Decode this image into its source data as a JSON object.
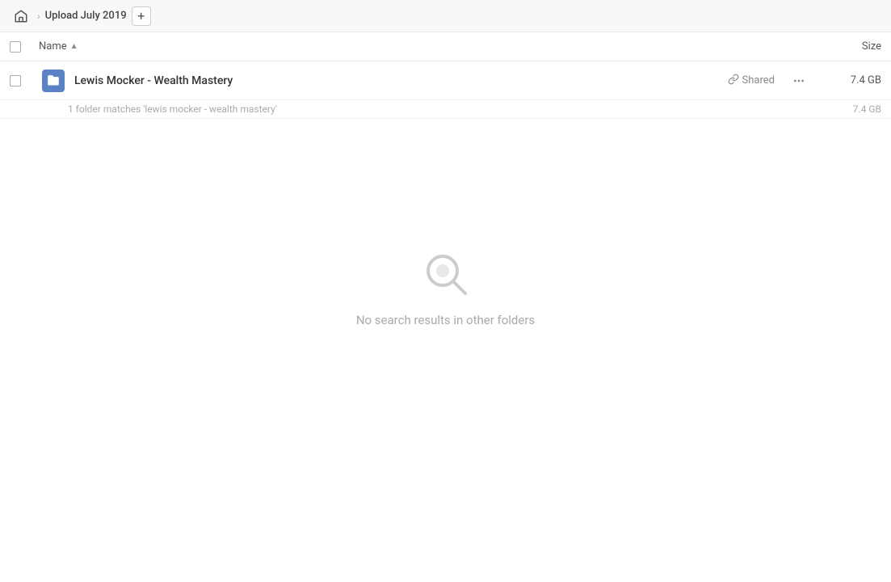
{
  "breadcrumb": {
    "home_icon": "🏠",
    "separator": "›",
    "title": "Upload July 2019",
    "add_button_label": "+"
  },
  "columns": {
    "name_label": "Name",
    "sort_indicator": "▲",
    "size_label": "Size"
  },
  "file_row": {
    "name": "Lewis Mocker - Wealth Mastery",
    "shared_label": "Shared",
    "size": "7.4 GB",
    "more_options_icon": "···"
  },
  "match_info": {
    "text": "1 folder matches 'lewis mocker - wealth mastery'",
    "size": "7.4 GB"
  },
  "empty_state": {
    "message": "No search results in other folders"
  }
}
